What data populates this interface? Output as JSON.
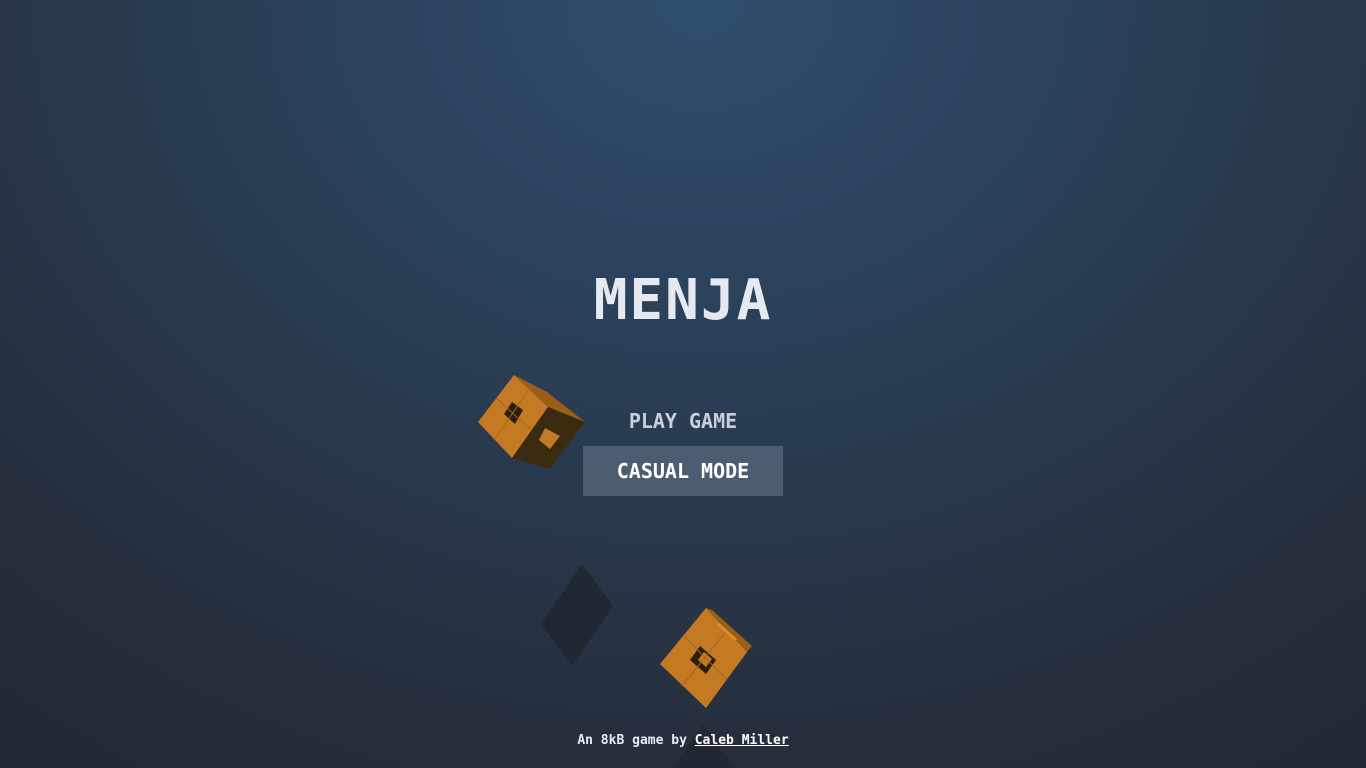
{
  "title": "MENJA",
  "menu": {
    "items": [
      {
        "label": "PLAY GAME",
        "selected": false
      },
      {
        "label": "CASUAL MODE",
        "selected": true
      }
    ]
  },
  "credit": {
    "prefix": "An 8kB game by ",
    "author": "Caleb Miller"
  },
  "colors": {
    "cube_face_light": "#c87a20",
    "cube_face_mid": "#a8651a",
    "cube_face_dark": "#3a2a10",
    "shadow": "#20262e"
  }
}
